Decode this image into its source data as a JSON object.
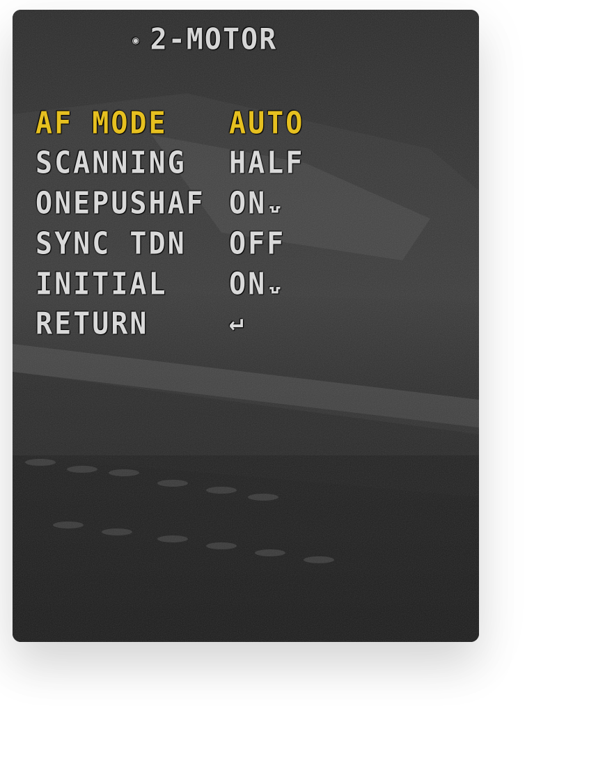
{
  "osd": {
    "title": "2-MOTOR",
    "title_icon": "eye-icon",
    "highlight_color": "#e6c020",
    "text_color": "#d9d9d9",
    "items": [
      {
        "label": "AF MODE",
        "value": "AUTO",
        "selected": true
      },
      {
        "label": "SCANNING",
        "value": "HALF",
        "selected": false
      },
      {
        "label": "ONEPUSHAF",
        "value": "ON",
        "icon": "enter-icon",
        "selected": false
      },
      {
        "label": "SYNC TDN",
        "value": "OFF",
        "selected": false
      },
      {
        "label": "INITIAL",
        "value": "ON",
        "icon": "enter-icon",
        "selected": false
      },
      {
        "label": "RETURN",
        "value": "",
        "icon": "return-arrow-icon",
        "selected": false
      }
    ]
  }
}
